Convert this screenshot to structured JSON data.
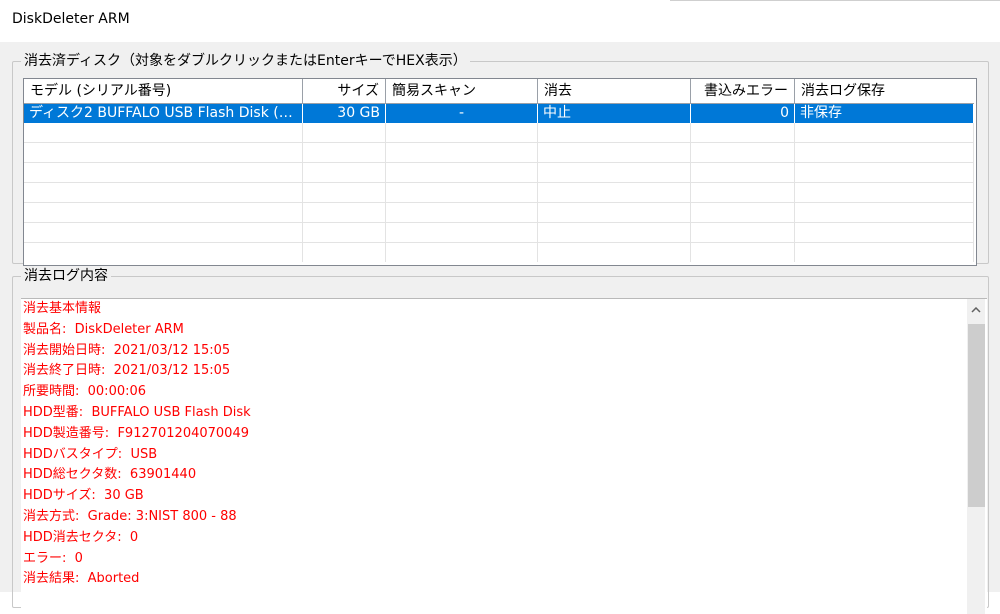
{
  "window": {
    "title": "DiskDeleter ARM"
  },
  "disks_group": {
    "label": "消去済ディスク（対象をダブルクリックまたはEnterキーでHEX表示）",
    "columns": [
      "モデル (シリアル番号)",
      "サイズ",
      "簡易スキャン",
      "消去",
      "書込みエラー",
      "消去ログ保存"
    ],
    "rows": [
      {
        "model": "ディスク2 BUFFALO USB Flash Disk (S/…",
        "size": "30 GB",
        "quick_scan": "-",
        "erase": "中止",
        "write_errors": "0",
        "log_saved": "非保存"
      }
    ]
  },
  "log_group": {
    "label": "消去ログ内容",
    "lines": [
      "消去基本情報",
      "製品名:  DiskDeleter ARM",
      "消去開始日時:  2021/03/12 15:05",
      "消去終了日時:  2021/03/12 15:05",
      "所要時間:  00:00:06",
      "HDD型番:  BUFFALO USB Flash Disk",
      "HDD製造番号:  F912701204070049",
      "HDDバスタイプ:  USB",
      "HDD総セクタ数:  63901440",
      "HDDサイズ:  30 GB",
      "消去方式:  Grade: 3:NIST 800 - 88",
      "HDD消去セクタ:  0",
      "エラー:  0",
      "消去結果:  Aborted"
    ]
  },
  "colors": {
    "selection": "#0078d7",
    "log_text": "#ff0000",
    "window_bg": "#f0f0f0"
  }
}
